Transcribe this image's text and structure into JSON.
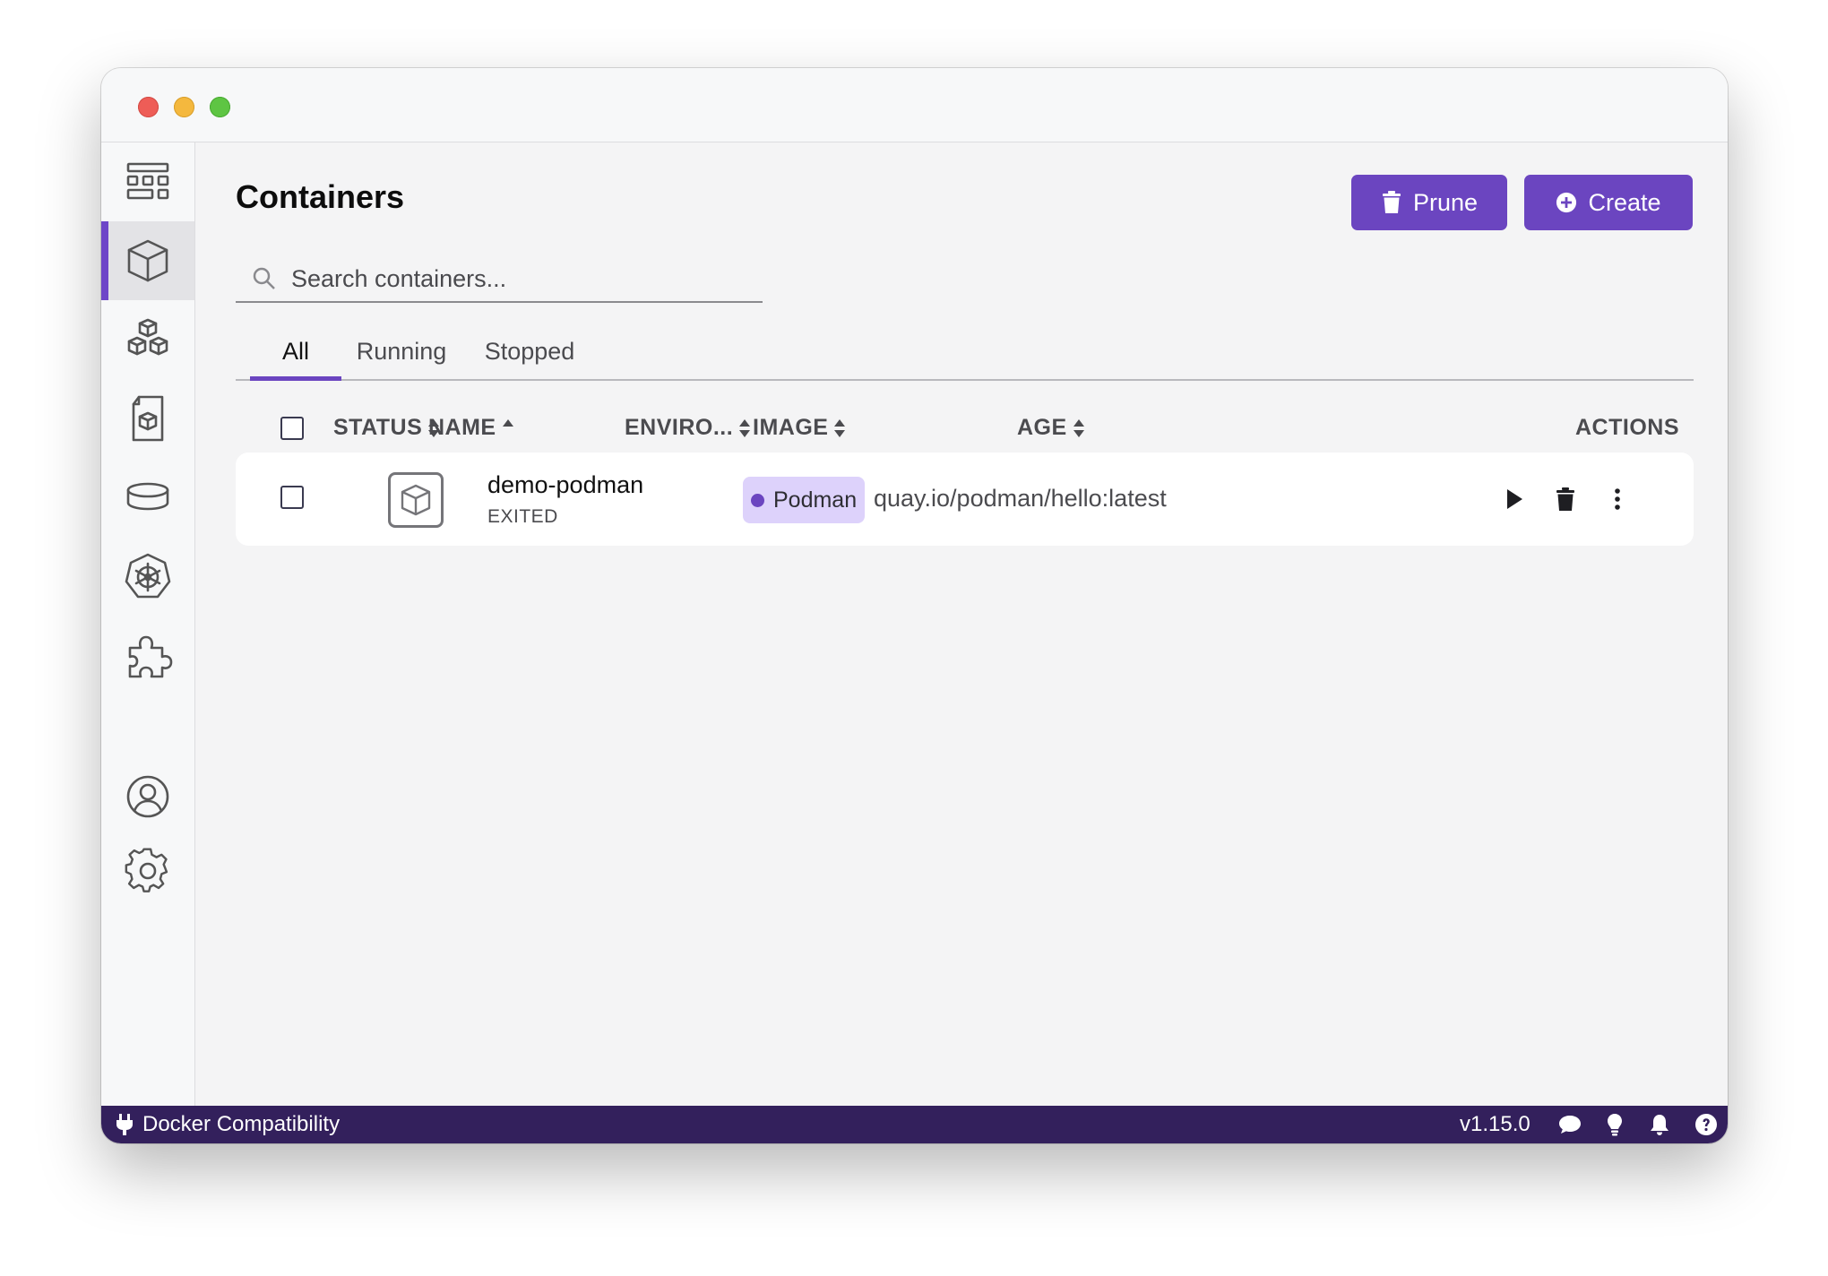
{
  "window": {
    "traffic_lights": [
      "close",
      "minimize",
      "zoom"
    ]
  },
  "sidebar": {
    "items": [
      {
        "name": "dashboard",
        "icon": "dashboard-icon"
      },
      {
        "name": "containers",
        "icon": "container-cube-icon",
        "active": true
      },
      {
        "name": "pods",
        "icon": "pods-icon"
      },
      {
        "name": "images",
        "icon": "image-icon"
      },
      {
        "name": "volumes",
        "icon": "volume-icon"
      },
      {
        "name": "kubernetes",
        "icon": "kubernetes-icon"
      },
      {
        "name": "extensions",
        "icon": "puzzle-icon"
      }
    ],
    "bottom": [
      {
        "name": "account",
        "icon": "user-circle-icon"
      },
      {
        "name": "settings",
        "icon": "gear-icon"
      }
    ]
  },
  "header": {
    "title": "Containers",
    "prune_label": "Prune",
    "create_label": "Create"
  },
  "search": {
    "placeholder": "Search containers...",
    "value": ""
  },
  "tabs": [
    {
      "label": "All",
      "active": true
    },
    {
      "label": "Running",
      "active": false
    },
    {
      "label": "Stopped",
      "active": false
    }
  ],
  "table": {
    "columns": {
      "status": "STATUS",
      "name": "NAME",
      "environment": "ENVIRO...",
      "image": "IMAGE",
      "age": "AGE",
      "actions": "ACTIONS"
    },
    "sorted_by": "name",
    "rows": [
      {
        "name": "demo-podman",
        "state": "EXITED",
        "environment": "Podman",
        "image": "quay.io/podman/hello:latest",
        "age": ""
      }
    ]
  },
  "statusbar": {
    "left_label": "Docker Compatibility",
    "version": "v1.15.0",
    "icons": [
      "chat-icon",
      "lightbulb-icon",
      "bell-icon",
      "help-icon"
    ]
  },
  "colors": {
    "accent": "#6b45c0",
    "statusbar": "#33205c",
    "badge_bg": "#ddd2fb"
  }
}
